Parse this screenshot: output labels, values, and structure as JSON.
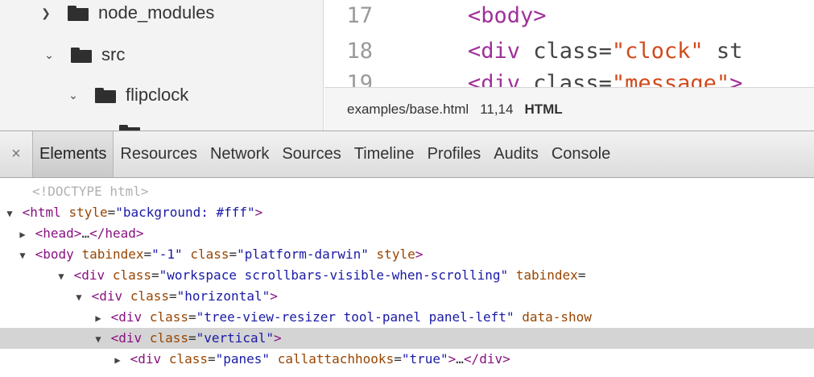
{
  "sidebar": {
    "items": [
      {
        "label": "node_modules",
        "expanded": false
      },
      {
        "label": "src",
        "expanded": true
      },
      {
        "label": "flipclock",
        "expanded": true
      }
    ]
  },
  "editor": {
    "lines": [
      {
        "num": "17",
        "code": "<body>"
      },
      {
        "num": "18",
        "code": "<div class=\"clock\" st"
      },
      {
        "num": "19",
        "code": "<div class=\"message\">"
      }
    ]
  },
  "status_bar": {
    "path": "examples/base.html",
    "position": "11,14",
    "language": "HTML"
  },
  "devtools": {
    "close_icon": "close-icon",
    "tabs": [
      "Elements",
      "Resources",
      "Network",
      "Sources",
      "Timeline",
      "Profiles",
      "Audits",
      "Console"
    ],
    "active_tab": "Elements",
    "dom": {
      "doctype": "<!DOCTYPE html>",
      "html_open": "<html style=\"background: #fff\">",
      "head": "<head>…</head>",
      "body_open": "<body tabindex=\"-1\" class=\"platform-darwin\" style>",
      "workspace": "<div class=\"workspace scrollbars-visible-when-scrolling\" tabindex=",
      "horizontal": "<div class=\"horizontal\">",
      "resizer": "<div class=\"tree-view-resizer tool-panel panel-left\" data-show",
      "vertical": "<div class=\"vertical\">",
      "panes": "<div class=\"panes\" callattachhooks=\"true\">…</div>"
    }
  },
  "colors": {
    "tag": "#881280",
    "attr": "#994500",
    "value": "#1a1aa6",
    "selected_row": "#d4d4d4"
  }
}
